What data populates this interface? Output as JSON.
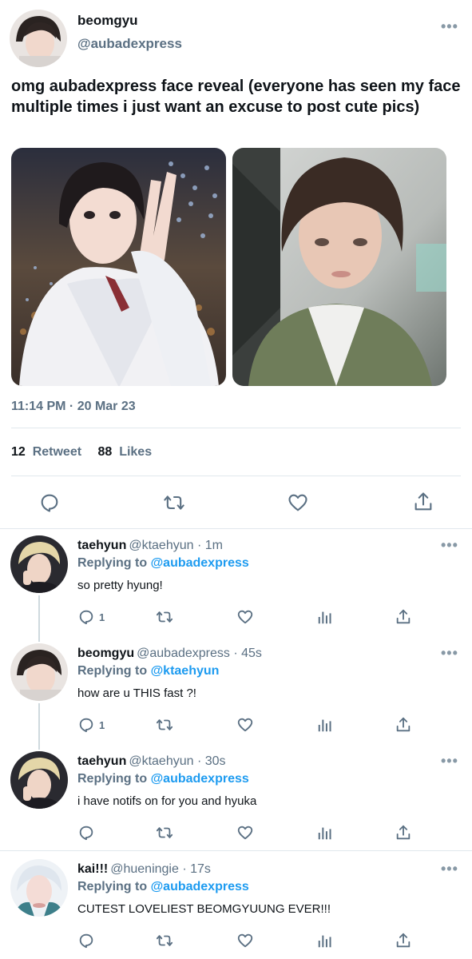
{
  "main": {
    "name": "beomgyu",
    "handle": "@aubadexpress",
    "more": "•••",
    "text": "omg aubadexpress face reveal (everyone has seen my face multiple times i just want an excuse to post cute pics)",
    "timestamp": "11:14 PM · 20 Mar 23",
    "retweets_count": "12",
    "retweets_label": "Retweet",
    "likes_count": "88",
    "likes_label": "Likes"
  },
  "replies": [
    {
      "name": "taehyun",
      "handle": "@ktaehyun · 1m",
      "replying_prefix": "Replying to",
      "replying_to": "@aubadexpress",
      "text": "so pretty hyung!",
      "reply_count": "1"
    },
    {
      "name": "beomgyu",
      "handle": "@aubadexpress · 45s",
      "replying_prefix": "Replying to",
      "replying_to": "@ktaehyun",
      "text": "how are u THIS fast ?!",
      "reply_count": "1"
    },
    {
      "name": "taehyun",
      "handle": "@ktaehyun · 30s",
      "replying_prefix": "Replying to",
      "replying_to": "@aubadexpress",
      "text": "i have notifs on for you and hyuka",
      "reply_count": ""
    },
    {
      "name": "kai!!!",
      "handle": "@hueningie · 17s",
      "replying_prefix": "Replying to",
      "replying_to": "@aubadexpress",
      "text": "CUTEST LOVELIEST BEOMGYUUNG EVER!!!",
      "reply_count": ""
    }
  ],
  "colors": {
    "link": "#1d9bf0",
    "muted": "#5b7083",
    "text": "#0f1419",
    "separator": "#e1e8ed"
  }
}
